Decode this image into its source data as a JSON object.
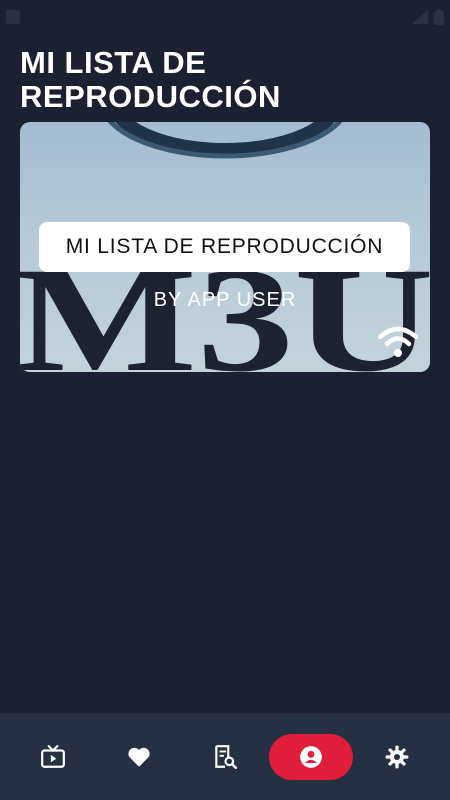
{
  "header": {
    "title": "MI LISTA DE REPRODUCCIÓN"
  },
  "playlist_card": {
    "name": "MI LISTA DE REPRODUCCIÓN",
    "author": "BY APP USER",
    "art_text": "M3U",
    "status_icon": "wifi-icon"
  },
  "bottom_nav": {
    "items": [
      {
        "icon": "tv-icon",
        "active": false
      },
      {
        "icon": "heart-icon",
        "active": false
      },
      {
        "icon": "list-search-icon",
        "active": false
      },
      {
        "icon": "user-icon",
        "active": true
      },
      {
        "icon": "gear-icon",
        "active": false
      }
    ]
  },
  "colors": {
    "background": "#1b2130",
    "nav_background": "#253042",
    "accent": "#e01e3c"
  }
}
